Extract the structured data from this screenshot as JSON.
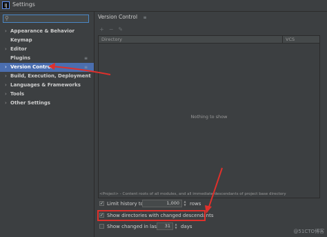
{
  "window": {
    "title": "Settings",
    "app_icon_text": "IJ"
  },
  "search": {
    "placeholder": "",
    "icon": "search-icon"
  },
  "sidebar": {
    "items": [
      {
        "label": "Appearance & Behavior",
        "chevron": "›"
      },
      {
        "label": "Keymap",
        "chevron": ""
      },
      {
        "label": "Editor",
        "chevron": "›"
      },
      {
        "label": "Plugins",
        "chevron": "",
        "badge": "≡"
      },
      {
        "label": "Version Control",
        "chevron": "›",
        "badge": "≡",
        "selected": true
      },
      {
        "label": "Build, Execution, Deployment",
        "chevron": "›"
      },
      {
        "label": "Languages & Frameworks",
        "chevron": "›"
      },
      {
        "label": "Tools",
        "chevron": "›"
      },
      {
        "label": "Other Settings",
        "chevron": "›"
      }
    ]
  },
  "main": {
    "title": "Version Control",
    "title_icon": "≡",
    "toolbar": {
      "add": "+",
      "remove": "−",
      "edit": "✎"
    },
    "table": {
      "columns": [
        "Directory",
        "VCS"
      ],
      "empty_text": "Nothing to show"
    },
    "roots_note": "<Project> - Content roots of all modules, and all immediate descendants of project base directory",
    "options": {
      "limit_history": {
        "label": "Limit history to:",
        "checked": true,
        "value": "1,000",
        "unit": "rows"
      },
      "show_dirs": {
        "label": "Show directories with changed descendants",
        "checked": true
      },
      "show_changed": {
        "label": "Show changed in last",
        "checked": false,
        "value": "31",
        "unit": "days"
      }
    }
  },
  "watermark": "@51CTO博客",
  "colors": {
    "accent": "#4b6eaf",
    "annotation": "#e0302b",
    "background": "#3c3f41"
  }
}
